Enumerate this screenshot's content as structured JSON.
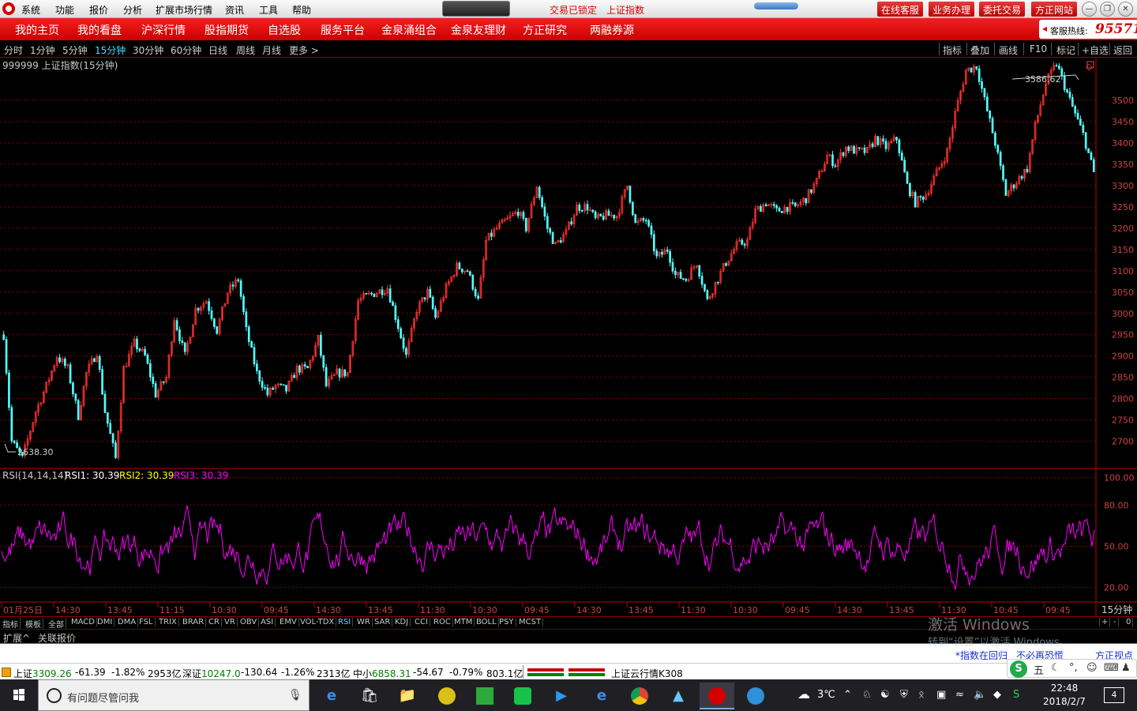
{
  "menubar": {
    "items": [
      "系统",
      "功能",
      "报价",
      "分析",
      "扩展市场行情",
      "资讯",
      "工具",
      "帮助"
    ],
    "locked_text": "交易已锁定",
    "current_index": "上证指数",
    "buttons": [
      "在线客服",
      "业务办理",
      "委托交易",
      "方正网站"
    ]
  },
  "navbar": {
    "items": [
      "我的主页",
      "我的看盘",
      "沪深行情",
      "股指期货",
      "自选股",
      "服务平台",
      "金泉涌组合",
      "金泉友理财",
      "方正研究",
      "两融券源"
    ],
    "hotline_label": "客服热线:",
    "hotline_number": "95571"
  },
  "periodbar": {
    "items": [
      "分时",
      "1分钟",
      "5分钟",
      "15分钟",
      "30分钟",
      "60分钟",
      "日线",
      "周线",
      "月线",
      "更多 >"
    ],
    "active": "15分钟",
    "tools": [
      "指标",
      "叠加",
      "画线",
      "F10",
      "标记",
      "+自选",
      "返回"
    ]
  },
  "chart_data": [
    {
      "type": "candlestick",
      "title": "999999 上证指数(15分钟)",
      "y_ticks": [
        2700,
        2750,
        2800,
        2850,
        2900,
        2950,
        3000,
        3050,
        3100,
        3150,
        3200,
        3250,
        3300,
        3350,
        3400,
        3450,
        3500
      ],
      "ylim": [
        2640,
        3600
      ],
      "max_label": "3586.62",
      "min_label": "2638.30",
      "grid": true,
      "colors": {
        "up": "#ff3232",
        "down": "#54fcfc",
        "grid": "#8b0000",
        "axis": "#c00000"
      },
      "path_nodes": [
        [
          0,
          2950
        ],
        [
          3,
          2700
        ],
        [
          7,
          2660
        ],
        [
          12,
          2770
        ],
        [
          16,
          2830
        ],
        [
          20,
          2900
        ],
        [
          24,
          2870
        ],
        [
          28,
          2760
        ],
        [
          31,
          2860
        ],
        [
          35,
          2910
        ],
        [
          38,
          2770
        ],
        [
          42,
          2660
        ],
        [
          45,
          2870
        ],
        [
          49,
          2930
        ],
        [
          53,
          2900
        ],
        [
          57,
          2810
        ],
        [
          61,
          2850
        ],
        [
          64,
          2990
        ],
        [
          68,
          2900
        ],
        [
          72,
          3010
        ],
        [
          76,
          3030
        ],
        [
          80,
          2960
        ],
        [
          84,
          3050
        ],
        [
          88,
          3080
        ],
        [
          91,
          2960
        ],
        [
          95,
          2860
        ],
        [
          99,
          2810
        ],
        [
          102,
          2830
        ],
        [
          106,
          2820
        ],
        [
          110,
          2870
        ],
        [
          114,
          2870
        ],
        [
          118,
          2940
        ],
        [
          121,
          2830
        ],
        [
          125,
          2860
        ],
        [
          129,
          2860
        ],
        [
          133,
          3030
        ],
        [
          136,
          3040
        ],
        [
          140,
          3050
        ],
        [
          144,
          3060
        ],
        [
          148,
          2970
        ],
        [
          151,
          2900
        ],
        [
          155,
          3010
        ],
        [
          159,
          3050
        ],
        [
          162,
          2990
        ],
        [
          166,
          3060
        ],
        [
          170,
          3110
        ],
        [
          174,
          3100
        ],
        [
          178,
          3030
        ],
        [
          181,
          3170
        ],
        [
          185,
          3200
        ],
        [
          189,
          3220
        ],
        [
          193,
          3240
        ],
        [
          196,
          3200
        ],
        [
          200,
          3300
        ],
        [
          204,
          3200
        ],
        [
          207,
          3160
        ],
        [
          211,
          3190
        ],
        [
          215,
          3250
        ],
        [
          219,
          3250
        ],
        [
          222,
          3220
        ],
        [
          226,
          3230
        ],
        [
          230,
          3230
        ],
        [
          234,
          3300
        ],
        [
          237,
          3210
        ],
        [
          241,
          3220
        ],
        [
          245,
          3130
        ],
        [
          249,
          3150
        ],
        [
          252,
          3090
        ],
        [
          256,
          3080
        ],
        [
          260,
          3120
        ],
        [
          264,
          3030
        ],
        [
          267,
          3070
        ],
        [
          271,
          3120
        ],
        [
          275,
          3160
        ],
        [
          279,
          3170
        ],
        [
          282,
          3240
        ],
        [
          286,
          3260
        ],
        [
          290,
          3240
        ],
        [
          294,
          3250
        ],
        [
          297,
          3250
        ],
        [
          301,
          3270
        ],
        [
          305,
          3310
        ],
        [
          309,
          3370
        ],
        [
          312,
          3350
        ],
        [
          316,
          3390
        ],
        [
          320,
          3380
        ],
        [
          324,
          3380
        ],
        [
          327,
          3410
        ],
        [
          331,
          3390
        ],
        [
          335,
          3410
        ],
        [
          339,
          3300
        ],
        [
          342,
          3260
        ],
        [
          346,
          3280
        ],
        [
          350,
          3330
        ],
        [
          354,
          3380
        ],
        [
          357,
          3470
        ],
        [
          361,
          3570
        ],
        [
          365,
          3580
        ],
        [
          368,
          3500
        ],
        [
          372,
          3400
        ],
        [
          376,
          3280
        ],
        [
          380,
          3310
        ],
        [
          384,
          3340
        ],
        [
          387,
          3440
        ],
        [
          391,
          3540
        ],
        [
          395,
          3586
        ],
        [
          400,
          3500
        ],
        [
          405,
          3420
        ],
        [
          409,
          3330
        ]
      ]
    },
    {
      "type": "line",
      "title": "RSI(14,14,14)",
      "series": [
        {
          "name": "RSI1",
          "value": "30.39"
        },
        {
          "name": "RSI2",
          "value": "30.39"
        },
        {
          "name": "RSI3",
          "value": "30.39"
        }
      ],
      "y_ticks": [
        20,
        50,
        80,
        100
      ],
      "y_tick_labels": [
        "20.00",
        "50.00",
        "80.00",
        "100.00"
      ],
      "ylim": [
        10,
        105
      ],
      "colors": {
        "rsi1": "#ffffff",
        "rsi2": "#ffff00",
        "rsi3": "#ff00ff",
        "line": "#ff00ff"
      }
    }
  ],
  "x_axis": {
    "labels": [
      "01月25日",
      "14:30",
      "13:45",
      "11:15",
      "10:30",
      "09:45",
      "14:30",
      "13:45",
      "11:30",
      "10:30",
      "09:45",
      "14:30",
      "13:45",
      "11:30",
      "10:30",
      "09:45",
      "14:30",
      "13:45",
      "11:30",
      "10:45",
      "09:45"
    ],
    "period_label": "15分钟"
  },
  "indicator_bar": {
    "items": [
      "指标",
      "模板",
      "全部",
      "MACD",
      "DMI",
      "DMA",
      "FSL",
      "TRIX",
      "BRAR",
      "CR",
      "VR",
      "OBV",
      "ASI",
      "EMV",
      "VOL-TDX",
      "RSI",
      "WR",
      "SAR",
      "KDJ",
      "CCI",
      "ROC",
      "MTM",
      "BOLL",
      "PSY",
      "MCST"
    ],
    "active": "RSI",
    "right_controls": [
      "+",
      "-",
      "0"
    ]
  },
  "ext_bar": {
    "items": [
      "扩展^",
      "关联报价"
    ]
  },
  "ticker_notices": [
    "*指数在回归",
    "不必再恐慌",
    "方正视点"
  ],
  "status": {
    "sh_label": "上证",
    "sh_value": "3309.26",
    "sh_change": "-61.39",
    "sh_pct": "-1.82%",
    "sh_amount": "2953亿",
    "sz_label": "深证",
    "sz_value": "10247.0",
    "sz_change": "-130.64",
    "sz_pct": "-1.26%",
    "sz_amount": "2313亿",
    "zx_label": "中小",
    "zx_value": "6858.31",
    "zx_change": "-54.67",
    "zx_pct": "-0.79%",
    "zx_amount": "803.1亿",
    "cloud": "上证云行情K308"
  },
  "watermark": {
    "line1": "激活 Windows",
    "line2": "转到“设置”以激活 Windows。"
  },
  "ime": {
    "label": "五"
  },
  "taskbar": {
    "search_placeholder": "有问题尽管问我",
    "weather": "3℃",
    "time": "22:48",
    "date": "2018/2/7",
    "notifications": "4"
  }
}
